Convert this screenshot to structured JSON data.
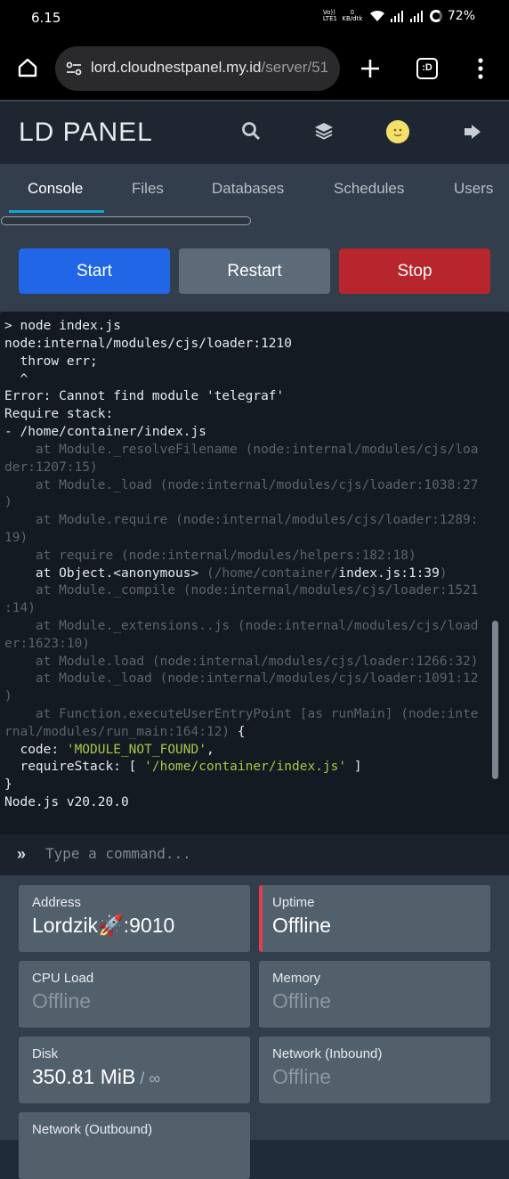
{
  "statusbar": {
    "time": "6.15",
    "volte": "Vo)) LTE1",
    "speed_value": "0",
    "speed_unit": "KB/dtk",
    "battery": "72%"
  },
  "browser": {
    "url_host": "lord.cloudnestpanel.my.id",
    "url_path": "/server/51",
    "tab_count_label": ":D"
  },
  "panel": {
    "logo": "LD PANEL"
  },
  "tabs": [
    {
      "label": "Console"
    },
    {
      "label": "Files"
    },
    {
      "label": "Databases"
    },
    {
      "label": "Schedules"
    },
    {
      "label": "Users"
    }
  ],
  "actions": {
    "start": "Start",
    "restart": "Restart",
    "stop": "Stop"
  },
  "console": {
    "lines": [
      "> node index.js",
      "node:internal/modules/cjs/loader:1210",
      "  throw err;",
      "  ^",
      "Error: Cannot find module 'telegraf'",
      "Require stack:",
      "- /home/container/index.js",
      "    at Module._resolveFilename (node:internal/modules/cjs/loa",
      "der:1207:15)",
      "    at Module._load (node:internal/modules/cjs/loader:1038:27",
      ")",
      "    at Module.require (node:internal/modules/cjs/loader:1289:",
      "19)",
      "    at require (node:internal/modules/helpers:182:18)",
      "    at Object.<anonymous>",
      " (/home/container/",
      "index.js:1:39",
      ")",
      "    at Module._compile (node:internal/modules/cjs/loader:1521",
      ":14)",
      "    at Module._extensions..js (node:internal/modules/cjs/load",
      "er:1623:10)",
      "    at Module.load (node:internal/modules/cjs/loader:1266:32)",
      "    at Module._load (node:internal/modules/cjs/loader:1091:12",
      ")",
      "    at Function.executeUserEntryPoint [as runMain] (node:inte",
      "rnal/modules/run_main:164:12)",
      " {",
      "  code: ",
      "'MODULE_NOT_FOUND'",
      ",",
      "  requireStack: [ ",
      "'/home/container/index.js'",
      " ]",
      "}",
      "Node.js v20.20.0"
    ],
    "input_placeholder": "Type a command..."
  },
  "stats": {
    "address": {
      "label": "Address",
      "value": "Lordzik🚀:9010"
    },
    "uptime": {
      "label": "Uptime",
      "value": "Offline"
    },
    "cpu": {
      "label": "CPU Load",
      "value": "Offline"
    },
    "memory": {
      "label": "Memory",
      "value": "Offline"
    },
    "disk": {
      "label": "Disk",
      "value": "350.81 MiB",
      "suffix": " / ∞"
    },
    "net_in": {
      "label": "Network (Inbound)",
      "value": "Offline"
    },
    "net_out": {
      "label": "Network (Outbound)"
    }
  },
  "colors": {
    "accent": "#1aa3d1",
    "start": "#2066e6",
    "restart": "#5d6b78",
    "stop": "#b6262c",
    "alert": "#e53e4d"
  }
}
